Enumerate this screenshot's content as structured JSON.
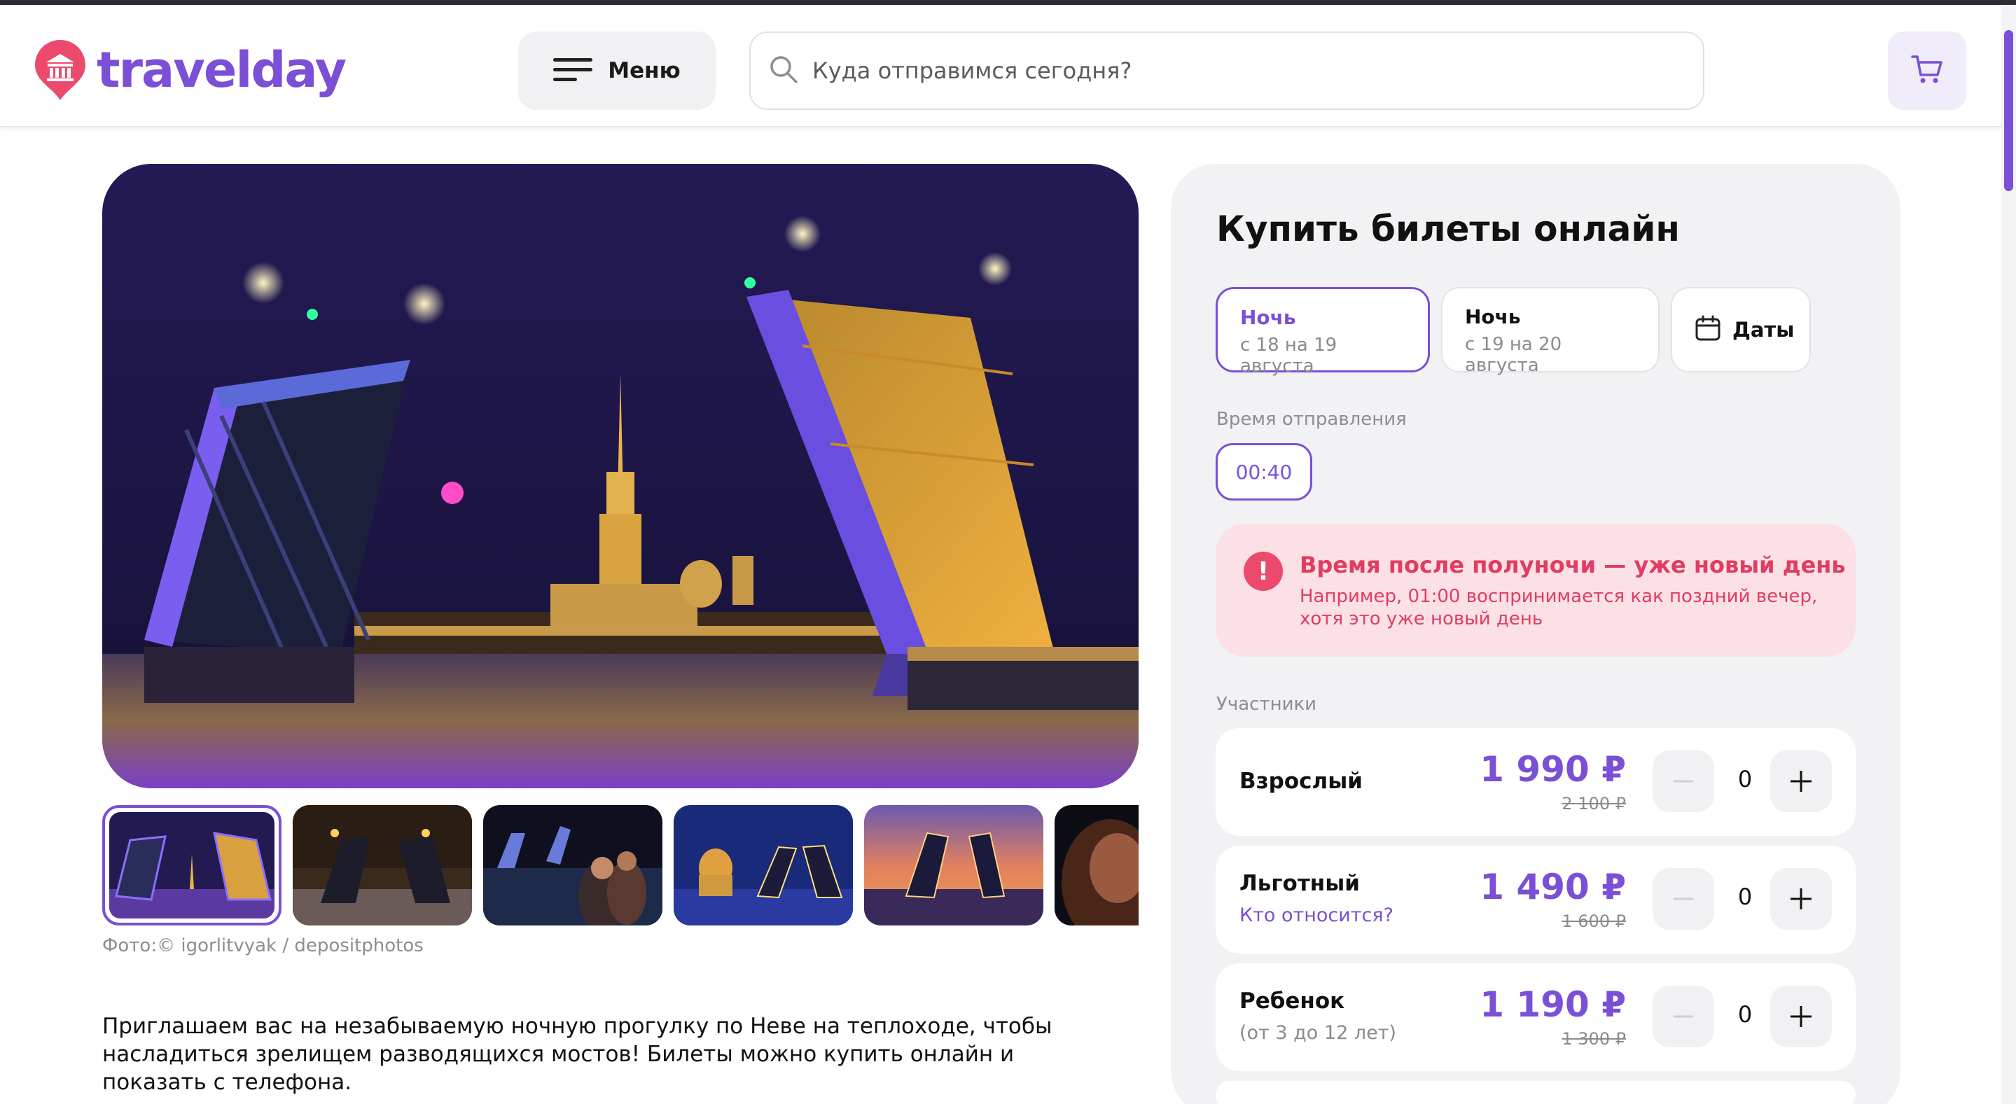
{
  "header": {
    "logo_text": "travelday",
    "menu_label": "Меню",
    "search_placeholder": "Куда отправимся сегодня?"
  },
  "gallery": {
    "credit": "Фото:© igorlitvyak / depositphotos"
  },
  "description": "Приглашаем вас на незабываемую ночную прогулку по Неве на теплоходе, чтобы насладиться зрелищем разводящихся мостов! Билеты можно купить онлайн и показать с телефона.",
  "booking": {
    "title": "Купить билеты онлайн",
    "dates": [
      {
        "title": "Ночь",
        "subtitle": "с 18 на 19 августа",
        "selected": true
      },
      {
        "title": "Ночь",
        "subtitle": "с 19 на 20 августа",
        "selected": false
      }
    ],
    "dates_button": "Даты",
    "departure_label": "Время отправления",
    "departure_time": "00:40",
    "notice": {
      "title": "Время после полуночи — уже новый день",
      "text": "Например, 01:00 воспринимается как поздний вечер, хотя это уже новый день"
    },
    "participants_label": "Участники",
    "participants": [
      {
        "name": "Взрослый",
        "subtitle": "",
        "price": "1 990 ₽",
        "old_price": "2 100 ₽",
        "count": "0"
      },
      {
        "name": "Льготный",
        "subtitle": "Кто относится?",
        "price": "1 490 ₽",
        "old_price": "1 600 ₽",
        "count": "0"
      },
      {
        "name": "Ребенок",
        "subtitle": "(от 3 до 12 лет)",
        "price": "1 190 ₽",
        "old_price": "1 300 ₽",
        "count": "0"
      }
    ]
  },
  "colors": {
    "accent": "#7b4fd6",
    "alert": "#e13c62",
    "alert_bg": "#fbe1e6",
    "logo_pin": "#ec4a6d"
  }
}
